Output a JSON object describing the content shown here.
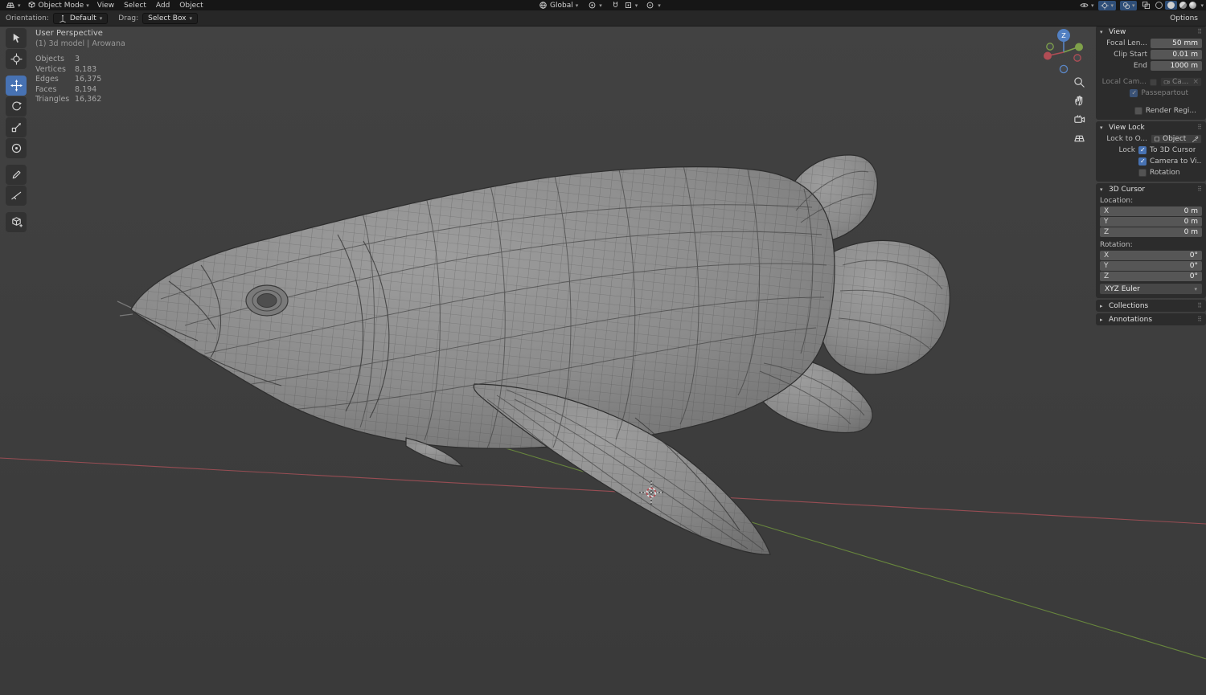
{
  "colors": {
    "accent": "#4772b3",
    "axis_x": "#a85058",
    "axis_y": "#6f923e",
    "viewport_bg": "#3d3d3d"
  },
  "topbar": {
    "mode": "Object Mode",
    "menus": [
      "View",
      "Select",
      "Add",
      "Object"
    ],
    "orientation": "Global"
  },
  "toolhead": {
    "orientation_label": "Orientation:",
    "orientation_value": "Default",
    "drag_label": "Drag:",
    "drag_value": "Select Box",
    "options_label": "Options"
  },
  "tools": {
    "items": [
      "select-box",
      "cursor",
      "move",
      "rotate",
      "scale",
      "transform",
      "annotate",
      "measure",
      "add-cube"
    ],
    "active": "move"
  },
  "viewport": {
    "view_label": "User Perspective",
    "scene_label": "(1) 3d model | Arowana",
    "stats": [
      {
        "label": "Objects",
        "value": "3"
      },
      {
        "label": "Vertices",
        "value": "8,183"
      },
      {
        "label": "Edges",
        "value": "16,375"
      },
      {
        "label": "Faces",
        "value": "8,194"
      },
      {
        "label": "Triangles",
        "value": "16,362"
      }
    ],
    "gizmo_z": "Z"
  },
  "sidebar": {
    "view": {
      "title": "View",
      "fields": [
        {
          "label": "Focal Len...",
          "value": "50 mm"
        },
        {
          "label": "Clip Start",
          "value": "0.01 m"
        },
        {
          "label": "End",
          "value": "1000 m"
        }
      ],
      "local_camera_label": "Local Cam...",
      "local_camera_value": "Ca...",
      "passepartout_label": "Passepartout",
      "render_region_label": "Render Regi..."
    },
    "view_lock": {
      "title": "View Lock",
      "lock_to_object_label": "Lock to O...",
      "lock_to_object_value": "Object",
      "lock_label": "Lock",
      "checkboxes": [
        {
          "label": "To 3D Cursor",
          "checked": true
        },
        {
          "label": "Camera to Vi...",
          "checked": true
        },
        {
          "label": "Rotation",
          "checked": false
        }
      ]
    },
    "cursor": {
      "title": "3D Cursor",
      "location_label": "Location:",
      "location": [
        {
          "axis": "X",
          "value": "0 m"
        },
        {
          "axis": "Y",
          "value": "0 m"
        },
        {
          "axis": "Z",
          "value": "0 m"
        }
      ],
      "rotation_label": "Rotation:",
      "rotation": [
        {
          "axis": "X",
          "value": "0°"
        },
        {
          "axis": "Y",
          "value": "0°"
        },
        {
          "axis": "Z",
          "value": "0°"
        }
      ],
      "rotation_mode": "XYZ Euler"
    },
    "collections_title": "Collections",
    "annotations_title": "Annotations"
  }
}
